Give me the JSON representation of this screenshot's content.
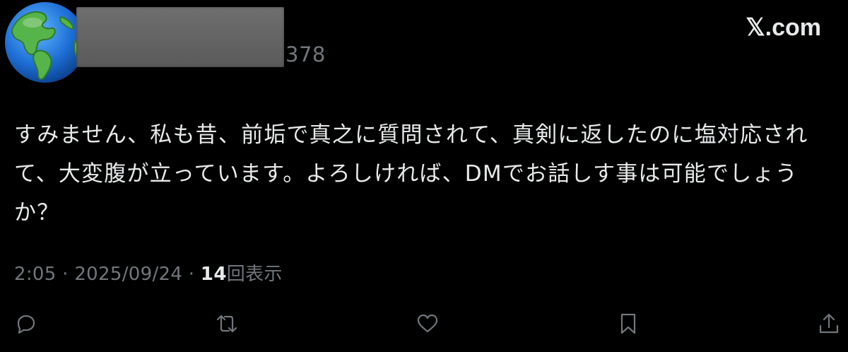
{
  "header": {
    "avatar_icon": "globe-americas-icon",
    "handle_suffix": "378",
    "brand": "𝕏.com"
  },
  "post": {
    "text": "すみません、私も昔、前垢で真之に質問されて、真剣に返したのに塩対応されて、大変腹が立っています。よろしければ、DMでお話しす事は可能でしょうか？",
    "time": "2:05",
    "date": "2025/09/24",
    "views_count": "14",
    "views_label": "回表示",
    "separator": "·"
  },
  "actions": {
    "icons": [
      "reply-icon",
      "repost-icon",
      "like-icon",
      "bookmark-icon",
      "share-icon"
    ]
  },
  "colors": {
    "background": "#000000",
    "text": "#e7e9ea",
    "secondary": "#71767b"
  }
}
